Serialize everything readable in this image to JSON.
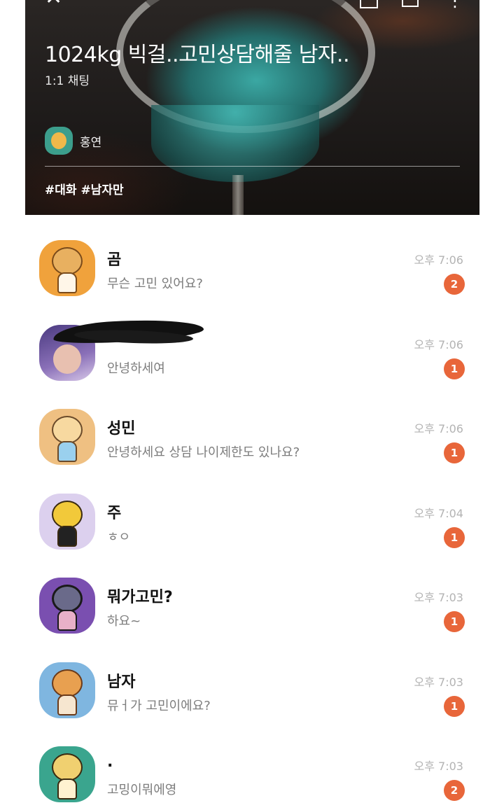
{
  "header": {
    "room_title": "1024kg 빅걸..고민상담해줄 남자..",
    "room_type": "1:1 채팅",
    "host_name": "홍연",
    "tags": "#대화 #남자만",
    "icons": {
      "close": "close-icon",
      "frame": "expand-frame-icon",
      "box": "share-box-icon",
      "more": "more-vert-icon"
    }
  },
  "chats": [
    {
      "name": "곰",
      "preview": "무슨 고민 있어요?",
      "time": "오후 7:06",
      "unread": "2",
      "avatar_color": "#f0a23c"
    },
    {
      "name": "",
      "preview": "안녕하세여",
      "time": "오후 7:06",
      "unread": "1",
      "avatar_color": "#6a4fa0"
    },
    {
      "name": "성민",
      "preview": "안녕하세요 상담 나이제한도 있나요?",
      "time": "오후 7:06",
      "unread": "1",
      "avatar_color": "#efc082"
    },
    {
      "name": "주",
      "preview": "ㅎㅇ",
      "time": "오후 7:04",
      "unread": "1",
      "avatar_color": "#dcd0ee"
    },
    {
      "name": "뭐가고민?",
      "preview": "하요~",
      "time": "오후 7:03",
      "unread": "1",
      "avatar_color": "#7a4fb0"
    },
    {
      "name": "남자",
      "preview": "뮤ㅓ가 고민이에요?",
      "time": "오후 7:03",
      "unread": "1",
      "avatar_color": "#7fb6e0"
    },
    {
      "name": ".",
      "preview": "고밍이뭐에영",
      "time": "오후 7:03",
      "unread": "2",
      "avatar_color": "#3aa58e"
    }
  ],
  "colors": {
    "badge": "#e8663a",
    "time": "#b3b3b3",
    "preview": "#7d7d7d"
  }
}
